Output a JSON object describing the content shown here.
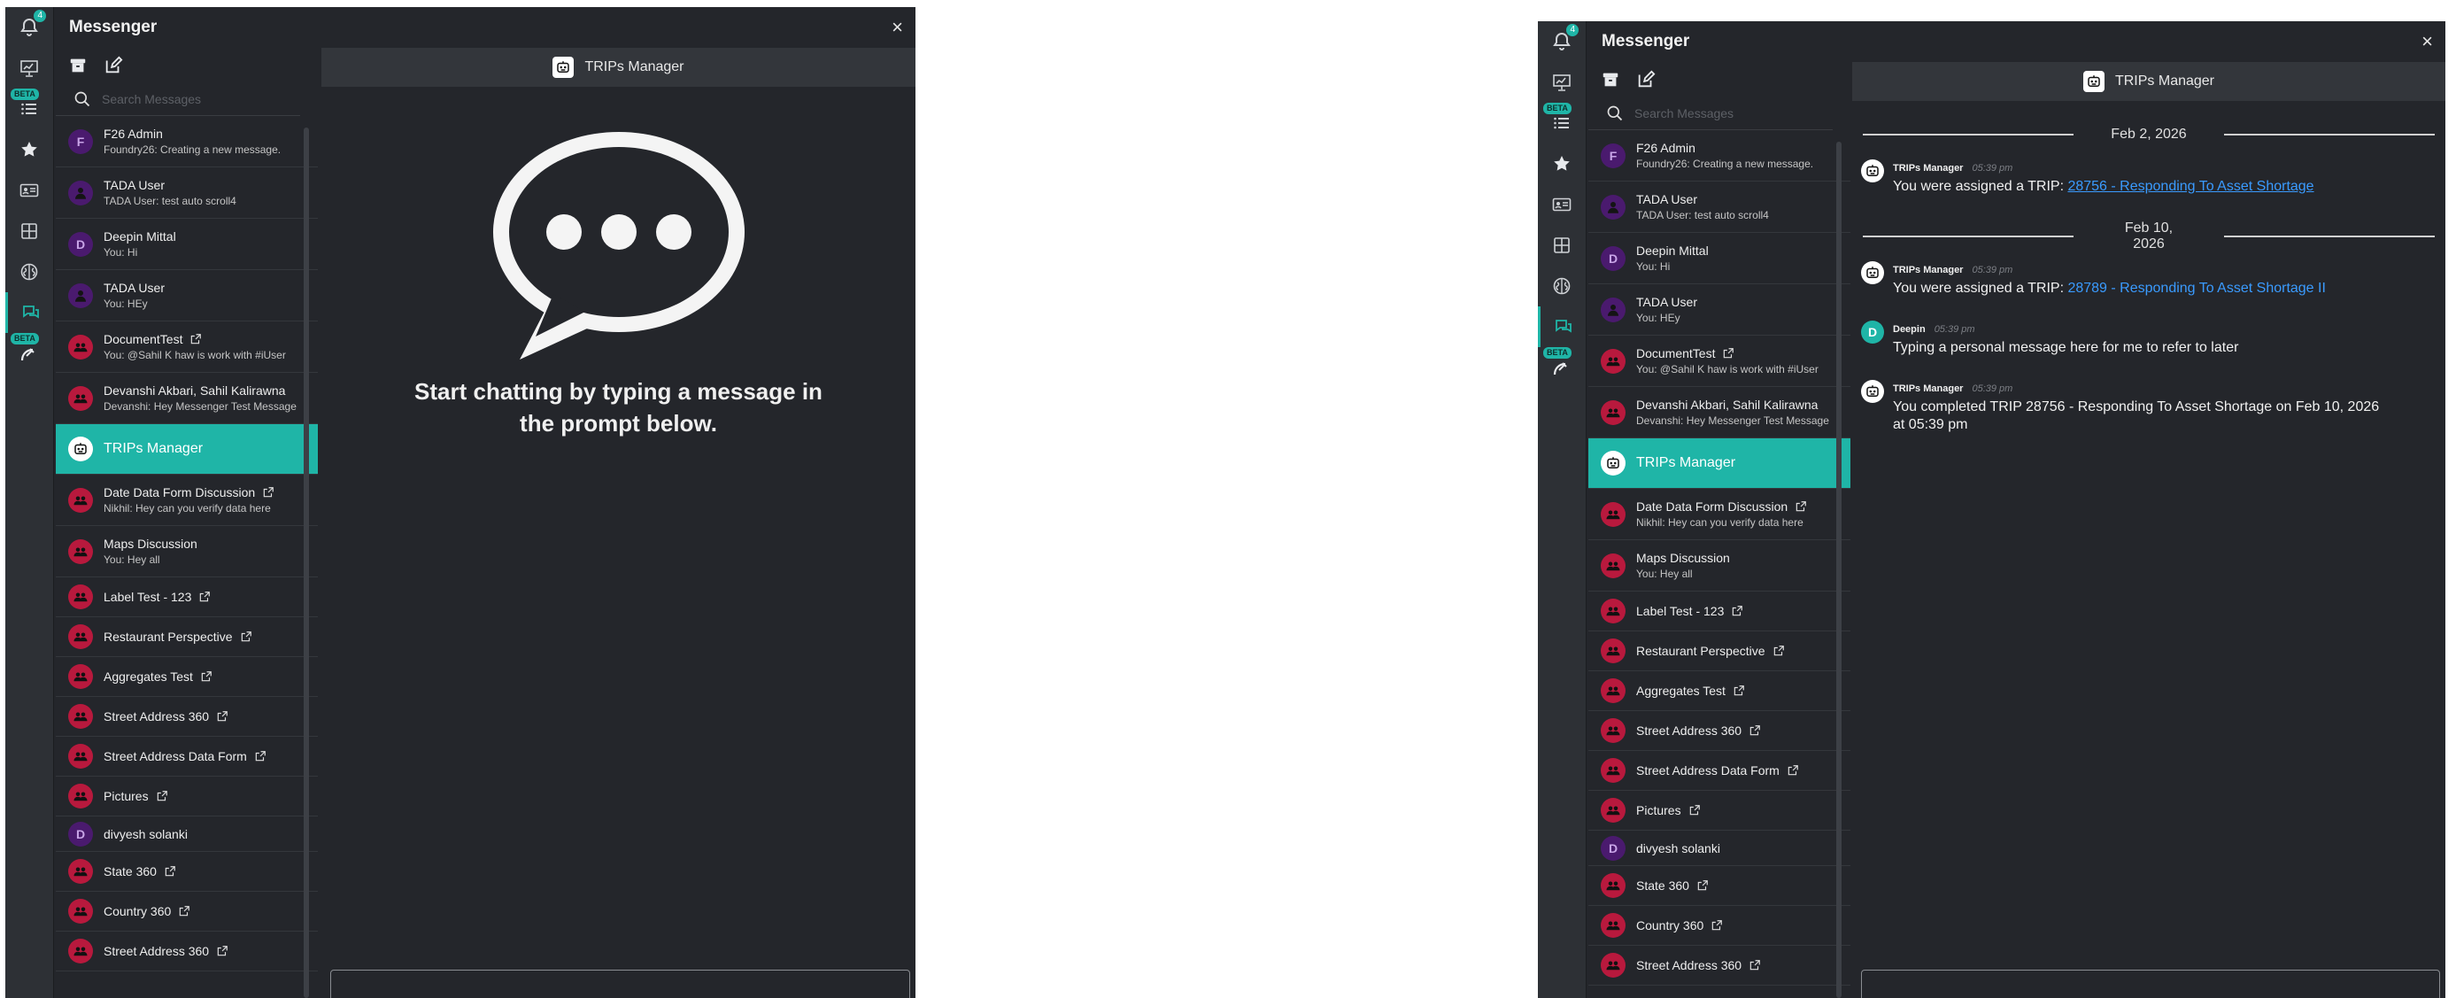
{
  "colors": {
    "accent": "#1fb5a7",
    "panel": "#24262b",
    "rail": "#2d3035",
    "red_avatar": "#b8193d",
    "purple_avatar": "#4a1a6e",
    "link": "#3a9bff"
  },
  "app": {
    "title": "Messenger",
    "close_label": "×"
  },
  "rail": {
    "badge_count": "4",
    "beta_label": "BETA",
    "items": [
      {
        "icon": "bell-icon"
      },
      {
        "icon": "presentation-icon"
      },
      {
        "icon": "list-icon"
      },
      {
        "icon": "star-icon"
      },
      {
        "icon": "id-card-icon"
      },
      {
        "icon": "grid-icon"
      },
      {
        "icon": "brain-icon"
      },
      {
        "icon": "chat-icon"
      },
      {
        "icon": "satellite-icon"
      }
    ]
  },
  "search": {
    "placeholder": "Search Messages"
  },
  "conversations": [
    {
      "name": "F26 Admin",
      "preview": "Foundry26: Creating a new message.",
      "avatar": "purple",
      "initial": "F",
      "ext": false
    },
    {
      "name": "TADA User",
      "preview": "TADA User: test auto scroll4",
      "avatar": "purple-user",
      "initial": "",
      "ext": false
    },
    {
      "name": "Deepin Mittal",
      "preview": "You: Hi",
      "avatar": "purple",
      "initial": "D",
      "ext": false
    },
    {
      "name": "TADA User",
      "preview": "You: HEy",
      "avatar": "purple-user",
      "initial": "",
      "ext": false
    },
    {
      "name": "DocumentTest",
      "preview": "You: @Sahil K haw is work with #iUser",
      "avatar": "red",
      "initial": "",
      "ext": true
    },
    {
      "name": "Devanshi Akbari, Sahil Kalirawna",
      "preview": "Devanshi: Hey Messenger Test Message",
      "avatar": "red",
      "initial": "",
      "ext": false
    },
    {
      "name": "TRIPs Manager",
      "preview": "",
      "avatar": "bot",
      "initial": "",
      "ext": false,
      "selected": true
    },
    {
      "name": "Date Data Form Discussion",
      "preview": "Nikhil: Hey can you verify data here",
      "avatar": "red",
      "initial": "",
      "ext": true
    },
    {
      "name": "Maps Discussion",
      "preview": "You: Hey all",
      "avatar": "red",
      "initial": "",
      "ext": false
    },
    {
      "name": "Label Test - 123",
      "preview": "",
      "avatar": "red",
      "initial": "",
      "ext": true
    },
    {
      "name": "Restaurant Perspective",
      "preview": "",
      "avatar": "red",
      "initial": "",
      "ext": true
    },
    {
      "name": "Aggregates Test",
      "preview": "",
      "avatar": "red",
      "initial": "",
      "ext": true
    },
    {
      "name": "Street Address 360",
      "preview": "",
      "avatar": "red",
      "initial": "",
      "ext": true
    },
    {
      "name": "Street Address Data Form",
      "preview": "",
      "avatar": "red",
      "initial": "",
      "ext": true
    },
    {
      "name": "Pictures",
      "preview": "",
      "avatar": "red",
      "initial": "",
      "ext": true
    },
    {
      "name": "divyesh solanki",
      "preview": "",
      "avatar": "purple",
      "initial": "D",
      "ext": false
    },
    {
      "name": "State 360",
      "preview": "",
      "avatar": "red",
      "initial": "",
      "ext": true
    },
    {
      "name": "Country 360",
      "preview": "",
      "avatar": "red",
      "initial": "",
      "ext": true
    },
    {
      "name": "Street Address 360",
      "preview": "",
      "avatar": "red",
      "initial": "",
      "ext": true
    }
  ],
  "chat": {
    "header": "TRIPs Manager",
    "empty_text": "Start chatting by typing a message in the prompt below.",
    "dates": [
      "Feb 2, 2026",
      "Feb 10, 2026"
    ],
    "messages": [
      {
        "sender": "TRIPs Manager",
        "time": "05:39 pm",
        "text": "You were assigned a TRIP: ",
        "link": "28756 - Responding To Asset Shortage",
        "link_underline": true,
        "avatar": "bot",
        "initial": "",
        "date_index": 0
      },
      {
        "sender": "TRIPs Manager",
        "time": "05:39 pm",
        "text": "You were assigned a TRIP: ",
        "link": "28789 - Responding To Asset Shortage II",
        "link_underline": false,
        "avatar": "bot",
        "initial": "",
        "date_index": 1
      },
      {
        "sender": "Deepin",
        "time": "05:39 pm",
        "text": "Typing a personal message here for me to refer to later",
        "link": "",
        "avatar": "teal",
        "initial": "D",
        "date_index": 1
      },
      {
        "sender": "TRIPs Manager",
        "time": "05:39 pm",
        "text": "You completed TRIP 28756 - Responding To Asset Shortage on Feb 10, 2026 at 05:39 pm",
        "link": "",
        "avatar": "bot",
        "initial": "",
        "date_index": 1
      }
    ]
  }
}
